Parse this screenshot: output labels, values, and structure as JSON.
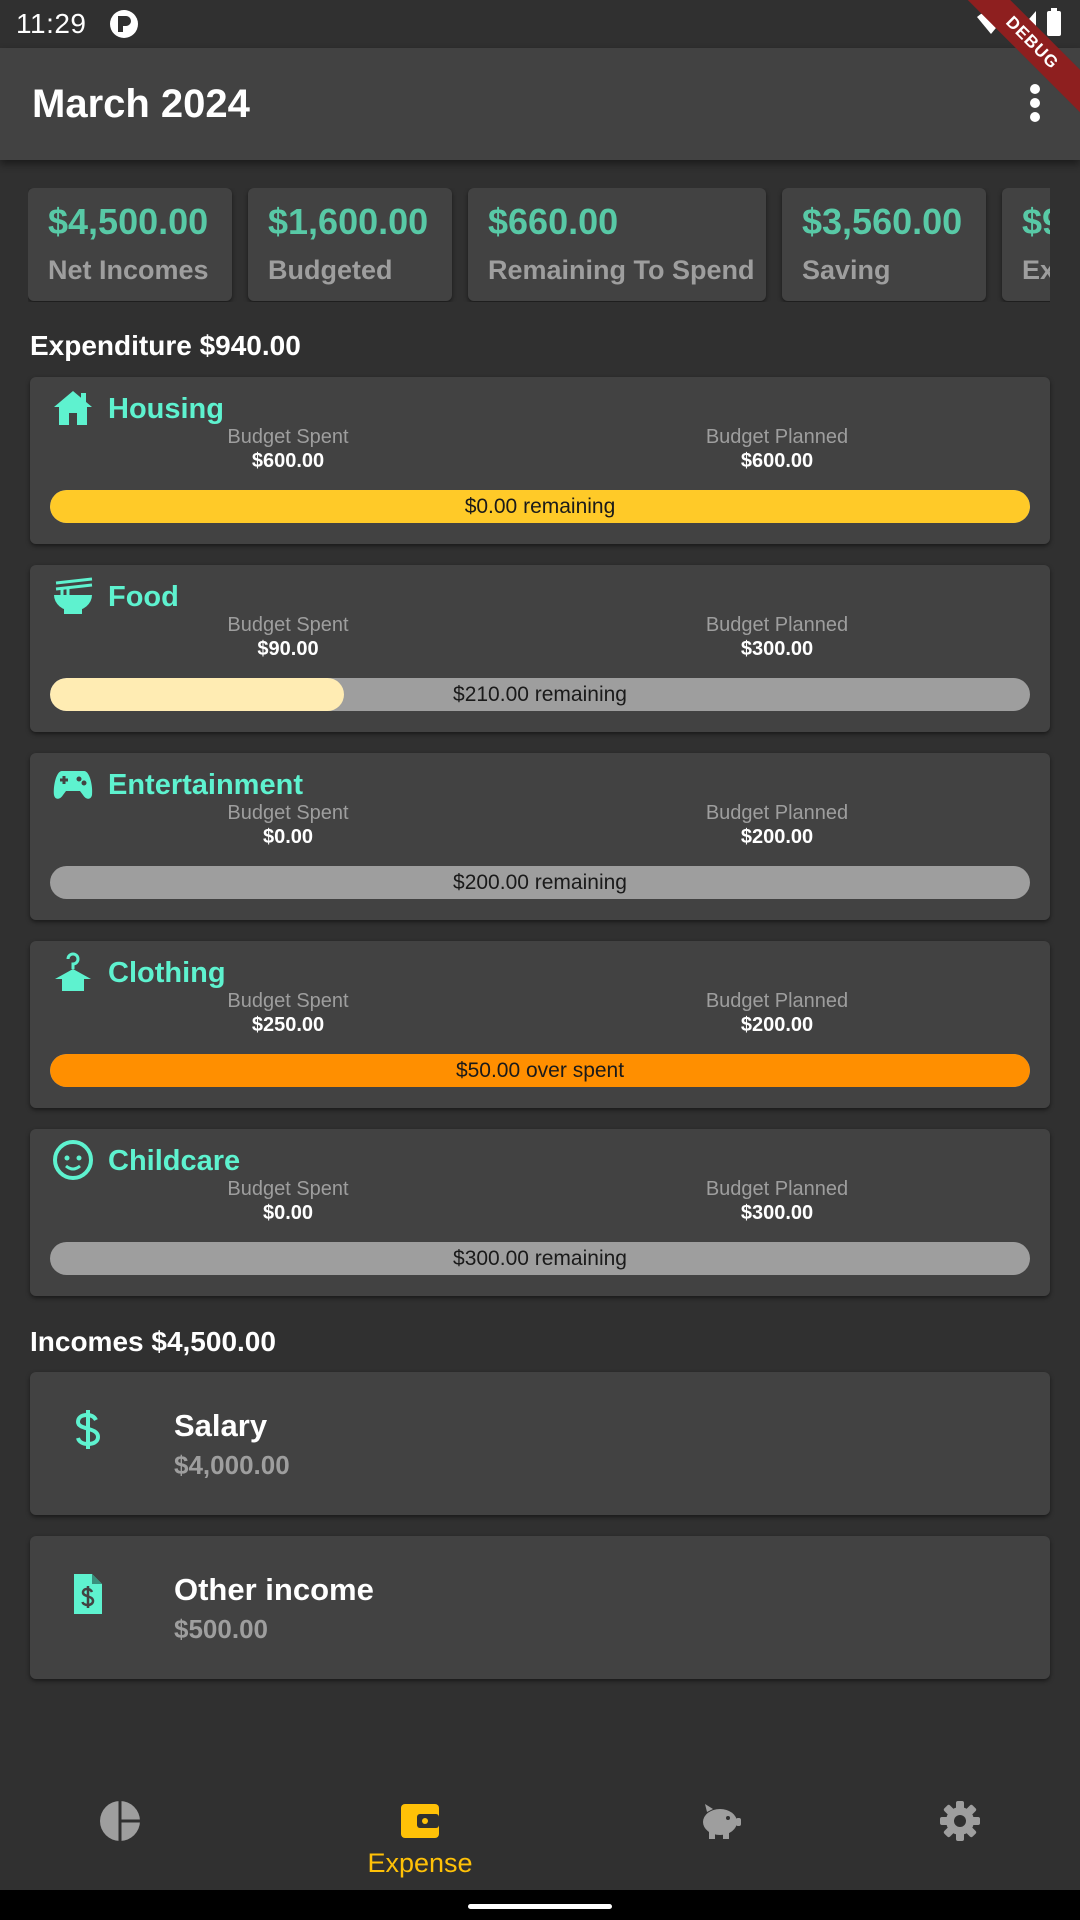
{
  "status_bar": {
    "time": "11:29"
  },
  "debug_banner": "DEBUG",
  "app_bar": {
    "title": "March 2024"
  },
  "summary": [
    {
      "value": "$4,500.00",
      "label": "Net Incomes"
    },
    {
      "value": "$1,600.00",
      "label": "Budgeted"
    },
    {
      "value": "$660.00",
      "label": "Remaining To Spend"
    },
    {
      "value": "$3,560.00",
      "label": "Saving"
    },
    {
      "value": "$9",
      "label": "Ex"
    }
  ],
  "expenditure": {
    "title": "Expenditure $940.00",
    "spent_label": "Budget Spent",
    "planned_label": "Budget Planned",
    "items": [
      {
        "name": "Housing",
        "icon": "home-icon",
        "spent": "$600.00",
        "planned": "$600.00",
        "progress": 1.0,
        "status": "$0.00 remaining",
        "fill_color": "#ffca28"
      },
      {
        "name": "Food",
        "icon": "noodle-bowl-icon",
        "spent": "$90.00",
        "planned": "$300.00",
        "progress": 0.3,
        "status": "$210.00 remaining",
        "fill_color": "#ffecb3"
      },
      {
        "name": "Entertainment",
        "icon": "gamepad-icon",
        "spent": "$0.00",
        "planned": "$200.00",
        "progress": 0.0,
        "status": "$200.00 remaining",
        "fill_color": "#ffecb3"
      },
      {
        "name": "Clothing",
        "icon": "hanger-icon",
        "spent": "$250.00",
        "planned": "$200.00",
        "progress": 1.0,
        "status": "$50.00  over spent",
        "fill_color": "#ff8f00"
      },
      {
        "name": "Childcare",
        "icon": "baby-face-icon",
        "spent": "$0.00",
        "planned": "$300.00",
        "progress": 0.0,
        "status": "$300.00 remaining",
        "fill_color": "#ffecb3"
      }
    ]
  },
  "incomes": {
    "title": "Incomes $4,500.00",
    "items": [
      {
        "name": "Salary",
        "amount": "$4,000.00",
        "icon": "dollar-icon"
      },
      {
        "name": "Other income",
        "amount": "$500.00",
        "icon": "invoice-dollar-icon"
      }
    ]
  },
  "bottom_nav": {
    "items": [
      {
        "icon": "pie-chart-icon",
        "label": ""
      },
      {
        "icon": "wallet-icon",
        "label": "Expense",
        "active": true
      },
      {
        "icon": "piggy-bank-icon",
        "label": ""
      },
      {
        "icon": "gear-icon",
        "label": ""
      }
    ]
  },
  "colors": {
    "accent": "#ffc107",
    "teal_value": "#58c9a6",
    "teal_title": "#5ef2cf",
    "card": "#424242",
    "background": "#303030"
  }
}
